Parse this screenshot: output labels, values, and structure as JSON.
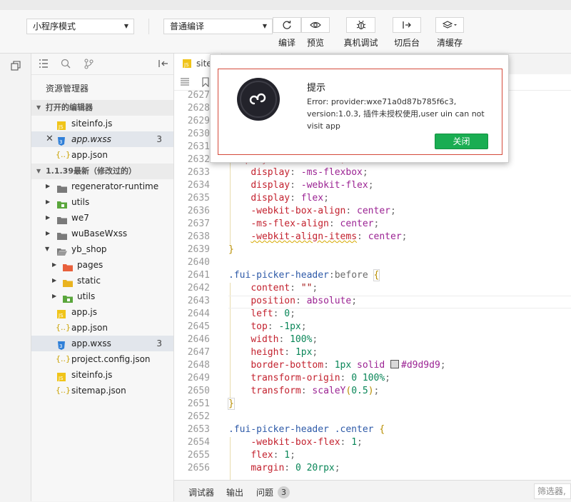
{
  "toolbar": {
    "mode_select": "小程序模式",
    "compile_select": "普通编译",
    "buttons": [
      {
        "label": "编译",
        "icon": "refresh-icon"
      },
      {
        "label": "预览",
        "icon": "eye-icon"
      },
      {
        "label": "真机调试",
        "icon": "bug-icon"
      },
      {
        "label": "切后台",
        "icon": "switch-background-icon"
      },
      {
        "label": "清缓存",
        "icon": "layers-icon"
      }
    ]
  },
  "explorer": {
    "title": "资源管理器",
    "open_editors_header": "打开的编辑器",
    "open_editors": [
      {
        "name": "siteinfo.js",
        "type": "js"
      },
      {
        "name": "app.wxss",
        "type": "wxss",
        "badge": "3",
        "modified": true
      },
      {
        "name": "app.json",
        "type": "json"
      }
    ],
    "project_header": "1.1.39最新（修改过的）",
    "tree": [
      {
        "name": "regenerator-runtime",
        "type": "folder"
      },
      {
        "name": "utils",
        "type": "folder-green"
      },
      {
        "name": "we7",
        "type": "folder"
      },
      {
        "name": "wuBaseWxss",
        "type": "folder"
      },
      {
        "name": "yb_shop",
        "type": "folder-open"
      },
      {
        "name": "pages",
        "type": "folder-red"
      },
      {
        "name": "static",
        "type": "folder-yellow"
      },
      {
        "name": "utils",
        "type": "folder-green"
      },
      {
        "name": "app.js",
        "type": "js"
      },
      {
        "name": "app.json",
        "type": "json"
      },
      {
        "name": "app.wxss",
        "type": "wxss",
        "badge": "3"
      },
      {
        "name": "project.config.json",
        "type": "json"
      },
      {
        "name": "siteinfo.js",
        "type": "js"
      },
      {
        "name": "sitemap.json",
        "type": "json"
      }
    ]
  },
  "editor": {
    "tab_label": "site",
    "line_numbers": [
      "2627",
      "2628",
      "2629",
      "2630",
      "2631",
      "2632",
      "2633",
      "2634",
      "2635",
      "2636",
      "2637",
      "2638",
      "2639",
      "2640",
      "2641",
      "2642",
      "2643",
      "2644",
      "2645",
      "2646",
      "2647",
      "2648",
      "2649",
      "2650",
      "2651",
      "2652",
      "2653",
      "2654",
      "2655",
      "2656"
    ],
    "code": {
      "l2632": "display: -webkit-box;",
      "l2633_p": "display",
      "l2633_v": "-ms-flexbox",
      "l2634_p": "display",
      "l2634_v": "-webkit-flex",
      "l2635_p": "display",
      "l2635_v": "flex",
      "l2636_p": "-webkit-box-align",
      "l2636_v": "center",
      "l2637_p": "-ms-flex-align",
      "l2637_v": "center",
      "l2638_p": "-webkit-align-items",
      "l2638_v": "center",
      "l2641_sel": ".fui-picker-header",
      "l2641_pseudo": ":before",
      "l2642_p": "content",
      "l2642_v": "\"\"",
      "l2643_p": "position",
      "l2643_v": "absolute",
      "l2644_p": "left",
      "l2644_v": "0",
      "l2645_p": "top",
      "l2645_v": "-1px",
      "l2646_p": "width",
      "l2646_v": "100%",
      "l2647_p": "height",
      "l2647_v": "1px",
      "l2648_p": "border-bottom",
      "l2648_v1": "1px",
      "l2648_v2": "solid",
      "l2648_v3": "#d9d9d9",
      "l2649_p": "transform-origin",
      "l2649_v": "0 100%",
      "l2650_p": "transform",
      "l2650_f": "scaleY",
      "l2650_v": "0.5",
      "l2653_sel": ".fui-picker-header .center",
      "l2654_p": "-webkit-box-flex",
      "l2654_v": "1",
      "l2655_p": "flex",
      "l2655_v": "1",
      "l2656_p": "margin",
      "l2656_v1": "0",
      "l2656_v2": "20rpx"
    }
  },
  "bottom": {
    "tabs": [
      "调试器",
      "输出",
      "问题"
    ],
    "problems_count": "3",
    "filter_placeholder": "筛选器,"
  },
  "dialog": {
    "title": "提示",
    "message": "Error: provider:wxe71a0d87b785f6c3, version:1.0.3, 插件未授权使用,user uin can not visit app",
    "button": "关闭"
  },
  "colors": {
    "accent_green": "#1aad52",
    "dialog_border": "#d44a3a",
    "swatch": "#d9d9d9"
  }
}
